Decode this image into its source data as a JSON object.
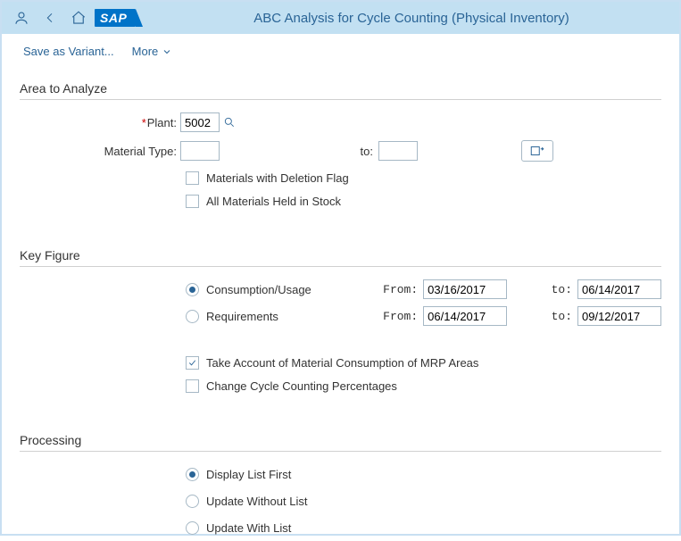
{
  "header": {
    "title": "ABC Analysis for Cycle Counting (Physical Inventory)",
    "logo_text": "SAP"
  },
  "toolbar": {
    "save_variant": "Save as Variant...",
    "more": "More"
  },
  "sections": {
    "area": {
      "title": "Area to Analyze",
      "plant_label": "Plant:",
      "plant_value": "5002",
      "material_type_label": "Material Type:",
      "material_type_value": "",
      "to_label": "to:",
      "to_value": "",
      "cb_deletion": "Materials with Deletion Flag",
      "cb_held": "All Materials Held in Stock"
    },
    "key_figure": {
      "title": "Key Figure",
      "rb_consumption": "Consumption/Usage",
      "rb_requirements": "Requirements",
      "from_label": "From:",
      "to_label": "to:",
      "cons_from": "03/16/2017",
      "cons_to": "06/14/2017",
      "req_from": "06/14/2017",
      "req_to": "09/12/2017",
      "cb_mrp": "Take Account of Material Consumption of MRP Areas",
      "cb_change_pct": "Change Cycle Counting Percentages"
    },
    "processing": {
      "title": "Processing",
      "rb_display_first": "Display List First",
      "rb_update_without": "Update Without List",
      "rb_update_with": "Update With List"
    }
  }
}
